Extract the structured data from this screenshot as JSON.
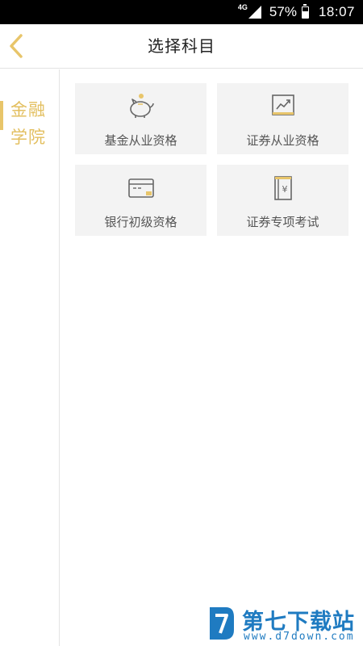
{
  "status_bar": {
    "network": "4G",
    "battery_text": "57%",
    "battery_level": 0.57,
    "time": "18:07"
  },
  "header": {
    "title": "选择科目",
    "back_icon": "chevron-left-icon",
    "accent_color": "#e8c56a"
  },
  "sidebar": {
    "items": [
      {
        "label": "金融学院",
        "selected": true
      }
    ]
  },
  "subjects": [
    {
      "label": "基金从业资格",
      "icon": "piggy-bank-icon"
    },
    {
      "label": "证券从业资格",
      "icon": "trend-chart-icon"
    },
    {
      "label": "银行初级资格",
      "icon": "bank-card-icon"
    },
    {
      "label": "证券专项考试",
      "icon": "yen-book-icon"
    }
  ],
  "watermark": {
    "main": "第七下载站",
    "sub": "www.d7down.com"
  }
}
